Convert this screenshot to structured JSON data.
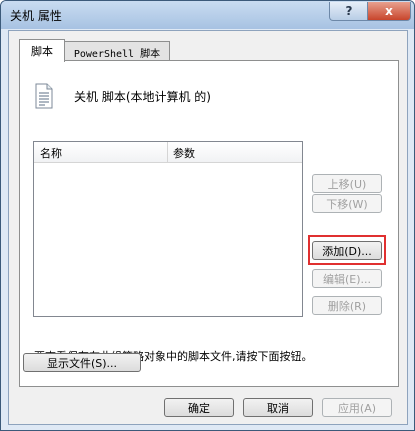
{
  "window": {
    "title": "关机 属性",
    "help_label": "?",
    "close_label": "x"
  },
  "tabs": [
    {
      "label": "脚本",
      "active": true
    },
    {
      "label": "PowerShell 脚本",
      "active": false
    }
  ],
  "panel": {
    "heading": "关机 脚本(本地计算机 的)",
    "icon": "script-file-icon",
    "list": {
      "columns": [
        "名称",
        "参数"
      ],
      "rows": []
    },
    "buttons": {
      "move_up": "上移(U)",
      "move_down": "下移(W)",
      "add": "添加(D)...",
      "edit": "编辑(E)...",
      "delete": "删除(R)"
    },
    "hint": "要查看保存在此组策略对象中的脚本文件,请按下面按钮。",
    "show_files": "显示文件(S)..."
  },
  "footer": {
    "ok": "确定",
    "cancel": "取消",
    "apply": "应用(A)"
  },
  "colors": {
    "highlight": "#e03030",
    "title_gradient_top": "#c9dcf1",
    "close_button": "#c8452c"
  }
}
